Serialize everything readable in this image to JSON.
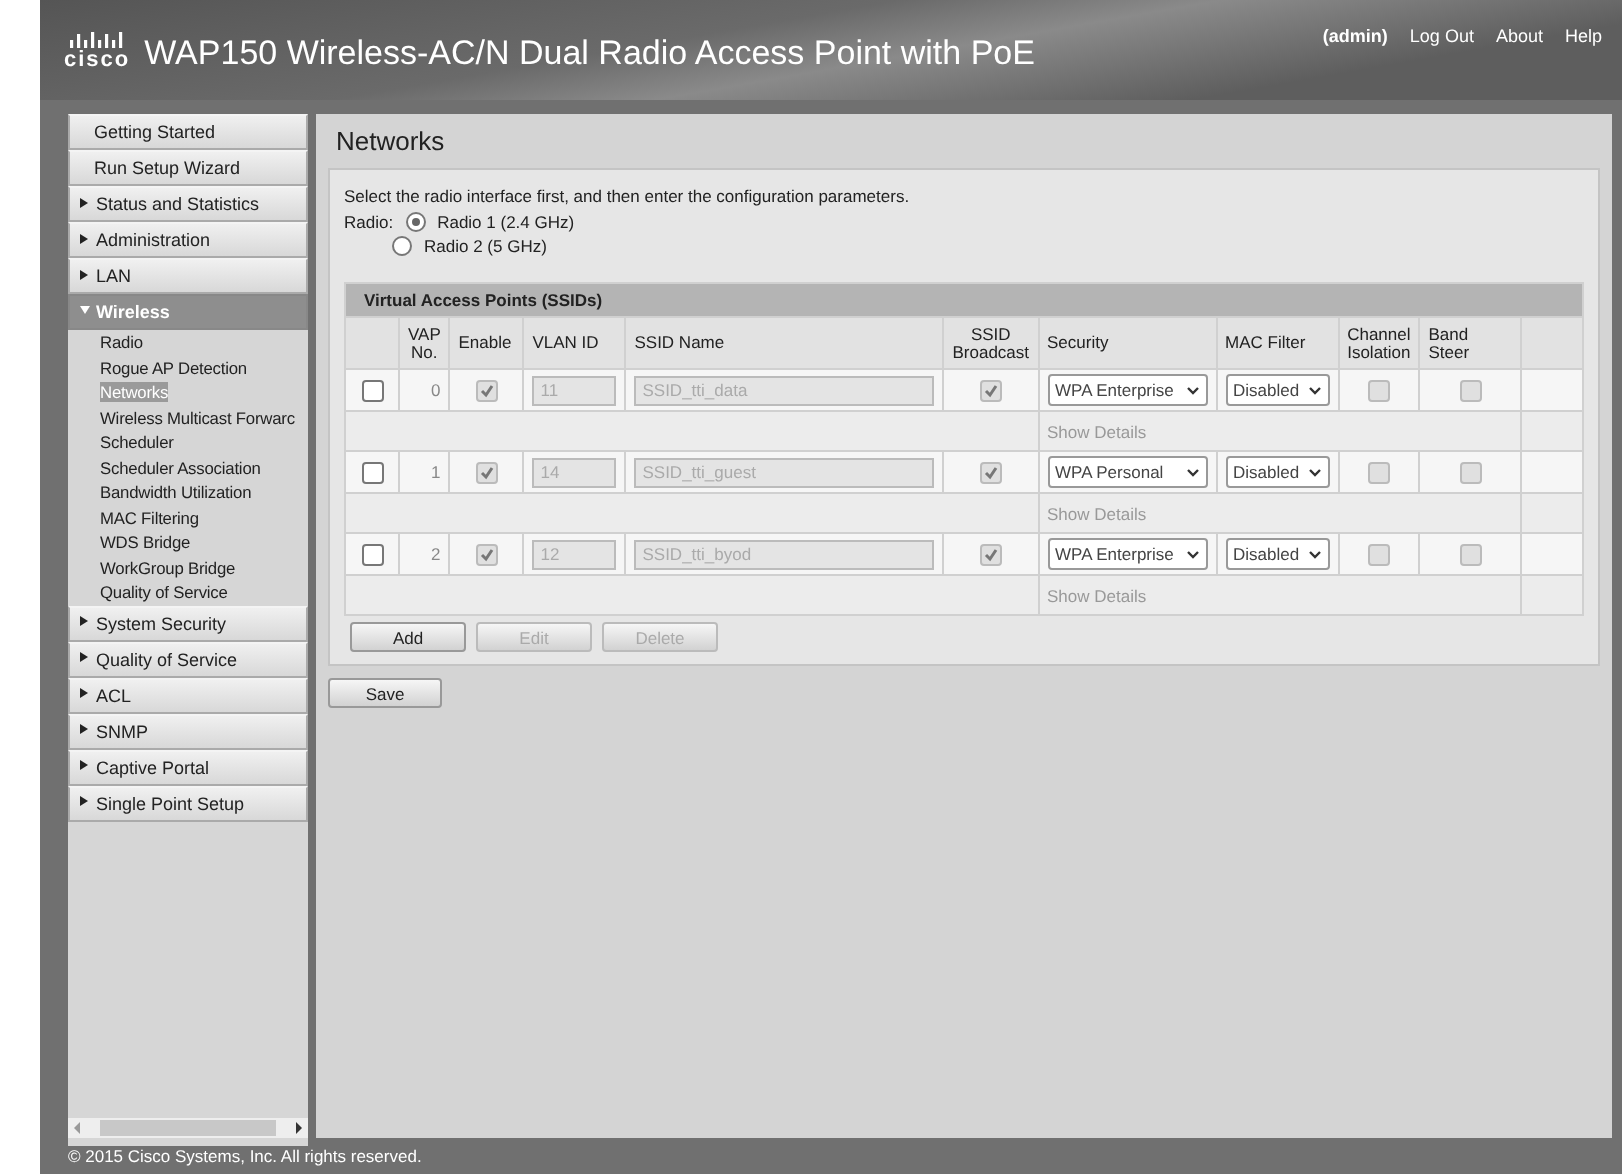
{
  "header": {
    "logo": "cisco",
    "title": "WAP150 Wireless-AC/N Dual Radio Access Point with PoE",
    "user": "(admin)",
    "links": [
      "Log Out",
      "About",
      "Help"
    ]
  },
  "sidebar": {
    "items": [
      {
        "label": "Getting Started",
        "kind": "plain",
        "expanded": false
      },
      {
        "label": "Run Setup Wizard",
        "kind": "plain",
        "expanded": false
      },
      {
        "label": "Status and Statistics",
        "kind": "group",
        "expanded": false
      },
      {
        "label": "Administration",
        "kind": "group",
        "expanded": false
      },
      {
        "label": "LAN",
        "kind": "group",
        "expanded": false
      },
      {
        "label": "Wireless",
        "kind": "group",
        "expanded": true,
        "children": [
          {
            "label": "Radio",
            "selected": false
          },
          {
            "label": "Rogue AP Detection",
            "selected": false
          },
          {
            "label": "Networks",
            "selected": true
          },
          {
            "label": "Wireless Multicast Forwarc",
            "selected": false
          },
          {
            "label": "Scheduler",
            "selected": false
          },
          {
            "label": "Scheduler Association",
            "selected": false
          },
          {
            "label": "Bandwidth Utilization",
            "selected": false
          },
          {
            "label": "MAC Filtering",
            "selected": false
          },
          {
            "label": "WDS Bridge",
            "selected": false
          },
          {
            "label": "WorkGroup Bridge",
            "selected": false
          },
          {
            "label": "Quality of Service",
            "selected": false
          }
        ]
      },
      {
        "label": "System Security",
        "kind": "group",
        "expanded": false
      },
      {
        "label": "Quality of Service",
        "kind": "group",
        "expanded": false
      },
      {
        "label": "ACL",
        "kind": "group",
        "expanded": false
      },
      {
        "label": "SNMP",
        "kind": "group",
        "expanded": false
      },
      {
        "label": "Captive Portal",
        "kind": "group",
        "expanded": false
      },
      {
        "label": "Single Point Setup",
        "kind": "group",
        "expanded": false
      }
    ]
  },
  "page": {
    "title": "Networks",
    "intro": "Select the radio interface first, and then enter the configuration parameters.",
    "radio_label": "Radio:",
    "radios": [
      {
        "label": "Radio 1 (2.4 GHz)",
        "selected": true
      },
      {
        "label": "Radio 2 (5 GHz)",
        "selected": false
      }
    ],
    "table": {
      "title": "Virtual Access Points (SSIDs)",
      "columns": [
        "VAP No.",
        "Enable",
        "VLAN ID",
        "SSID Name",
        "SSID Broadcast",
        "Security",
        "MAC Filter",
        "Channel Isolation",
        "Band Steer"
      ],
      "rows": [
        {
          "checked": false,
          "vap_no": "0",
          "enable": true,
          "vlan_id": "11",
          "ssid_name": "SSID_tti_data",
          "broadcast": true,
          "security": "WPA Enterprise",
          "mac_filter": "Disabled",
          "channel_isolation": false,
          "band_steer": false,
          "details": "Show Details"
        },
        {
          "checked": false,
          "vap_no": "1",
          "enable": true,
          "vlan_id": "14",
          "ssid_name": "SSID_tti_guest",
          "broadcast": true,
          "security": "WPA Personal",
          "mac_filter": "Disabled",
          "channel_isolation": false,
          "band_steer": false,
          "details": "Show Details"
        },
        {
          "checked": false,
          "vap_no": "2",
          "enable": true,
          "vlan_id": "12",
          "ssid_name": "SSID_tti_byod",
          "broadcast": true,
          "security": "WPA Enterprise",
          "mac_filter": "Disabled",
          "channel_isolation": false,
          "band_steer": false,
          "details": "Show Details"
        }
      ]
    },
    "table_buttons": [
      {
        "label": "Add",
        "disabled": false
      },
      {
        "label": "Edit",
        "disabled": true
      },
      {
        "label": "Delete",
        "disabled": true
      }
    ],
    "save": "Save"
  },
  "footer": "© 2015 Cisco Systems, Inc. All rights reserved."
}
